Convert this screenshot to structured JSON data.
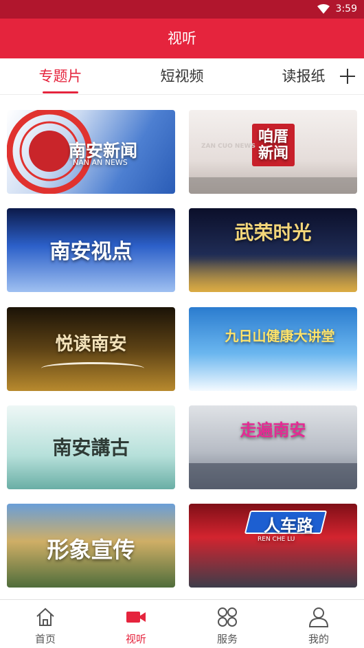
{
  "status_bar": {
    "time": "3:59",
    "wifi_icon": "wifi-icon"
  },
  "header": {
    "title": "视听"
  },
  "tabs": [
    {
      "label": "专题片",
      "active": true
    },
    {
      "label": "短视频",
      "active": false
    },
    {
      "label": "读报纸",
      "active": false
    }
  ],
  "tab_add_icon": "plus-icon",
  "programs": [
    {
      "title": "南安新闻",
      "subtitle": "NAN AN NEWS"
    },
    {
      "title": "咱厝新闻",
      "subtitle": "ZAN CUO NEWS"
    },
    {
      "title": "南安视点",
      "subtitle": ""
    },
    {
      "title": "武荣时光",
      "subtitle": ""
    },
    {
      "title": "悦读南安",
      "subtitle": ""
    },
    {
      "title": "九日山健康大讲堂",
      "subtitle": ""
    },
    {
      "title": "南安講古",
      "subtitle": ""
    },
    {
      "title": "走遍南安",
      "subtitle": ""
    },
    {
      "title": "形象宣传",
      "subtitle": ""
    },
    {
      "title": "人车路",
      "subtitle": "REN CHE LU"
    }
  ],
  "bottom_nav": [
    {
      "label": "首页",
      "icon": "home-icon",
      "active": false
    },
    {
      "label": "视听",
      "icon": "video-camera-icon",
      "active": true
    },
    {
      "label": "服务",
      "icon": "grid-icon",
      "active": false
    },
    {
      "label": "我的",
      "icon": "user-icon",
      "active": false
    }
  ],
  "colors": {
    "accent": "#e5243d",
    "status_bar": "#b1162d"
  }
}
